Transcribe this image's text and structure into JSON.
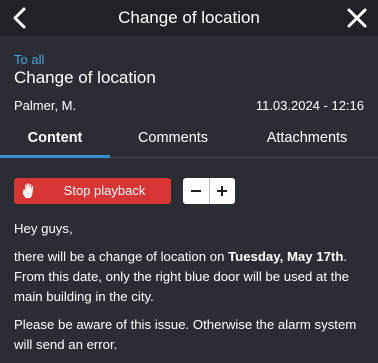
{
  "topbar": {
    "back_icon": "chevron-left-icon",
    "title": "Change of location",
    "close_icon": "close-icon"
  },
  "header": {
    "breadcrumb": "To all",
    "title": "Change of location",
    "author": "Palmer, M.",
    "datetime": "11.03.2024 - 12:16"
  },
  "tabs": [
    {
      "label": "Content",
      "active": true
    },
    {
      "label": "Comments",
      "active": false
    },
    {
      "label": "Attachments",
      "active": false
    }
  ],
  "controls": {
    "stop_label": "Stop playback",
    "stop_icon": "hand-icon",
    "minus_label": "−",
    "plus_label": "+"
  },
  "message": {
    "greeting": "Hey guys,",
    "p1_before": "there will be a change of location on ",
    "p1_bold": "Tuesday, May 17th",
    "p1_after": ". From this date, only the right blue door will be used at the main building in the city.",
    "p2": "Please be aware of this issue. Otherwise the alarm system will send an error."
  },
  "colors": {
    "background": "#2b2d35",
    "topbar": "#202228",
    "accent": "#3a8fd0",
    "link": "#4aa3df",
    "danger": "#d83535"
  }
}
